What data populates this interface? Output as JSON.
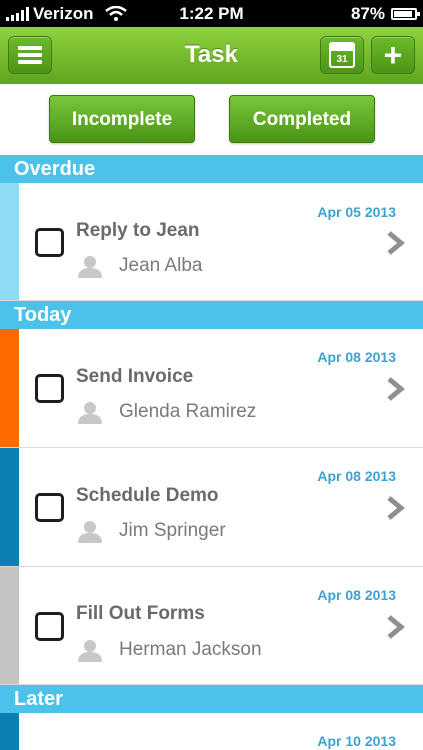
{
  "status_bar": {
    "carrier": "Verizon",
    "time": "1:22 PM",
    "battery": "87%"
  },
  "nav": {
    "title": "Task",
    "calendar_day": "31"
  },
  "segments": {
    "incomplete": "Incomplete",
    "completed": "Completed"
  },
  "sections": {
    "overdue": "Overdue",
    "today": "Today",
    "later": "Later"
  },
  "tasks": [
    {
      "title": "Reply to Jean",
      "person": "Jean Alba",
      "date": "Apr 05 2013",
      "color": "#8fdcf7"
    },
    {
      "title": "Send Invoice",
      "person": "Glenda Ramirez",
      "date": "Apr 08 2013",
      "color": "#ff6a00"
    },
    {
      "title": "Schedule Demo",
      "person": "Jim Springer",
      "date": "Apr 08 2013",
      "color": "#0d7fb3"
    },
    {
      "title": "Fill Out Forms",
      "person": "Herman Jackson",
      "date": "Apr 08 2013",
      "color": "#c4c4c4"
    },
    {
      "title": "",
      "person": "",
      "date": "Apr 10 2013",
      "color": "#0d7fb3"
    }
  ],
  "colors": {
    "nav_green": "#6cba2a",
    "section_blue": "#4cc1ea",
    "date_blue": "#3ea2cf"
  }
}
